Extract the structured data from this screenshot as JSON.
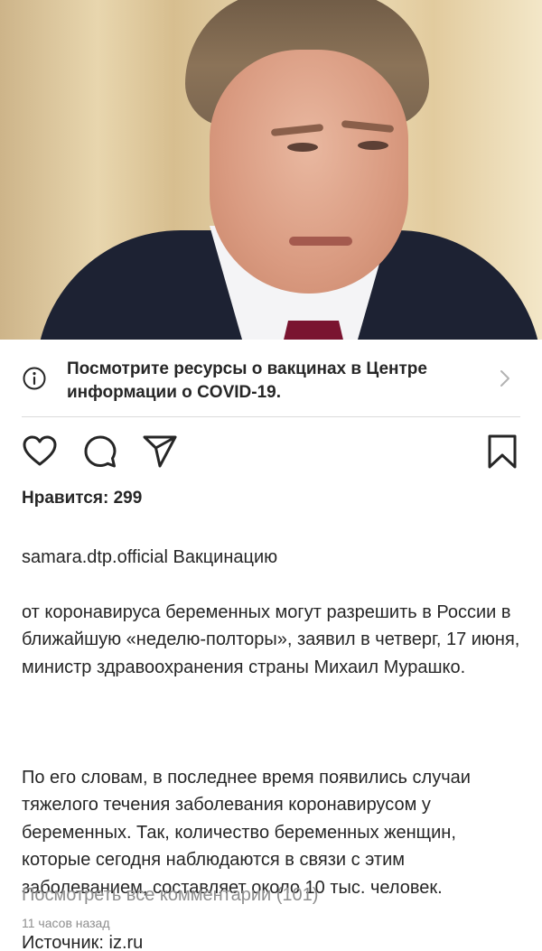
{
  "post": {
    "image_alt": "",
    "covid_banner": {
      "text": "Посмотрите ресурсы о вакцинах в Центре информации о COVID-19.",
      "icon": "info-icon"
    },
    "actions": {
      "like_icon": "heart-icon",
      "comment_icon": "comment-icon",
      "share_icon": "send-icon",
      "save_icon": "bookmark-icon"
    },
    "likes": "Нравится: 299",
    "username": "samara.dtp.official",
    "caption_line1": " Вакцинацию",
    "caption_p1": "от коронавируса беременных могут разрешить в России в ближайшую «неделю-полторы», заявил в четверг, 17 июня, министр здравоохранения страны Михаил Мурашко.",
    "caption_p2": "По его словам, в последнее время появились случаи тяжелого течения заболевания коронавирусом у беременных. Так, количество беременных женщин, которые сегодня наблюдаются в связи с этим заболеванием, составляет около 10 тыс. человек.",
    "caption_source": "Источник: iz.ru",
    "view_comments": "Посмотреть все комментарии (101)",
    "timestamp": "11 часов назад"
  }
}
